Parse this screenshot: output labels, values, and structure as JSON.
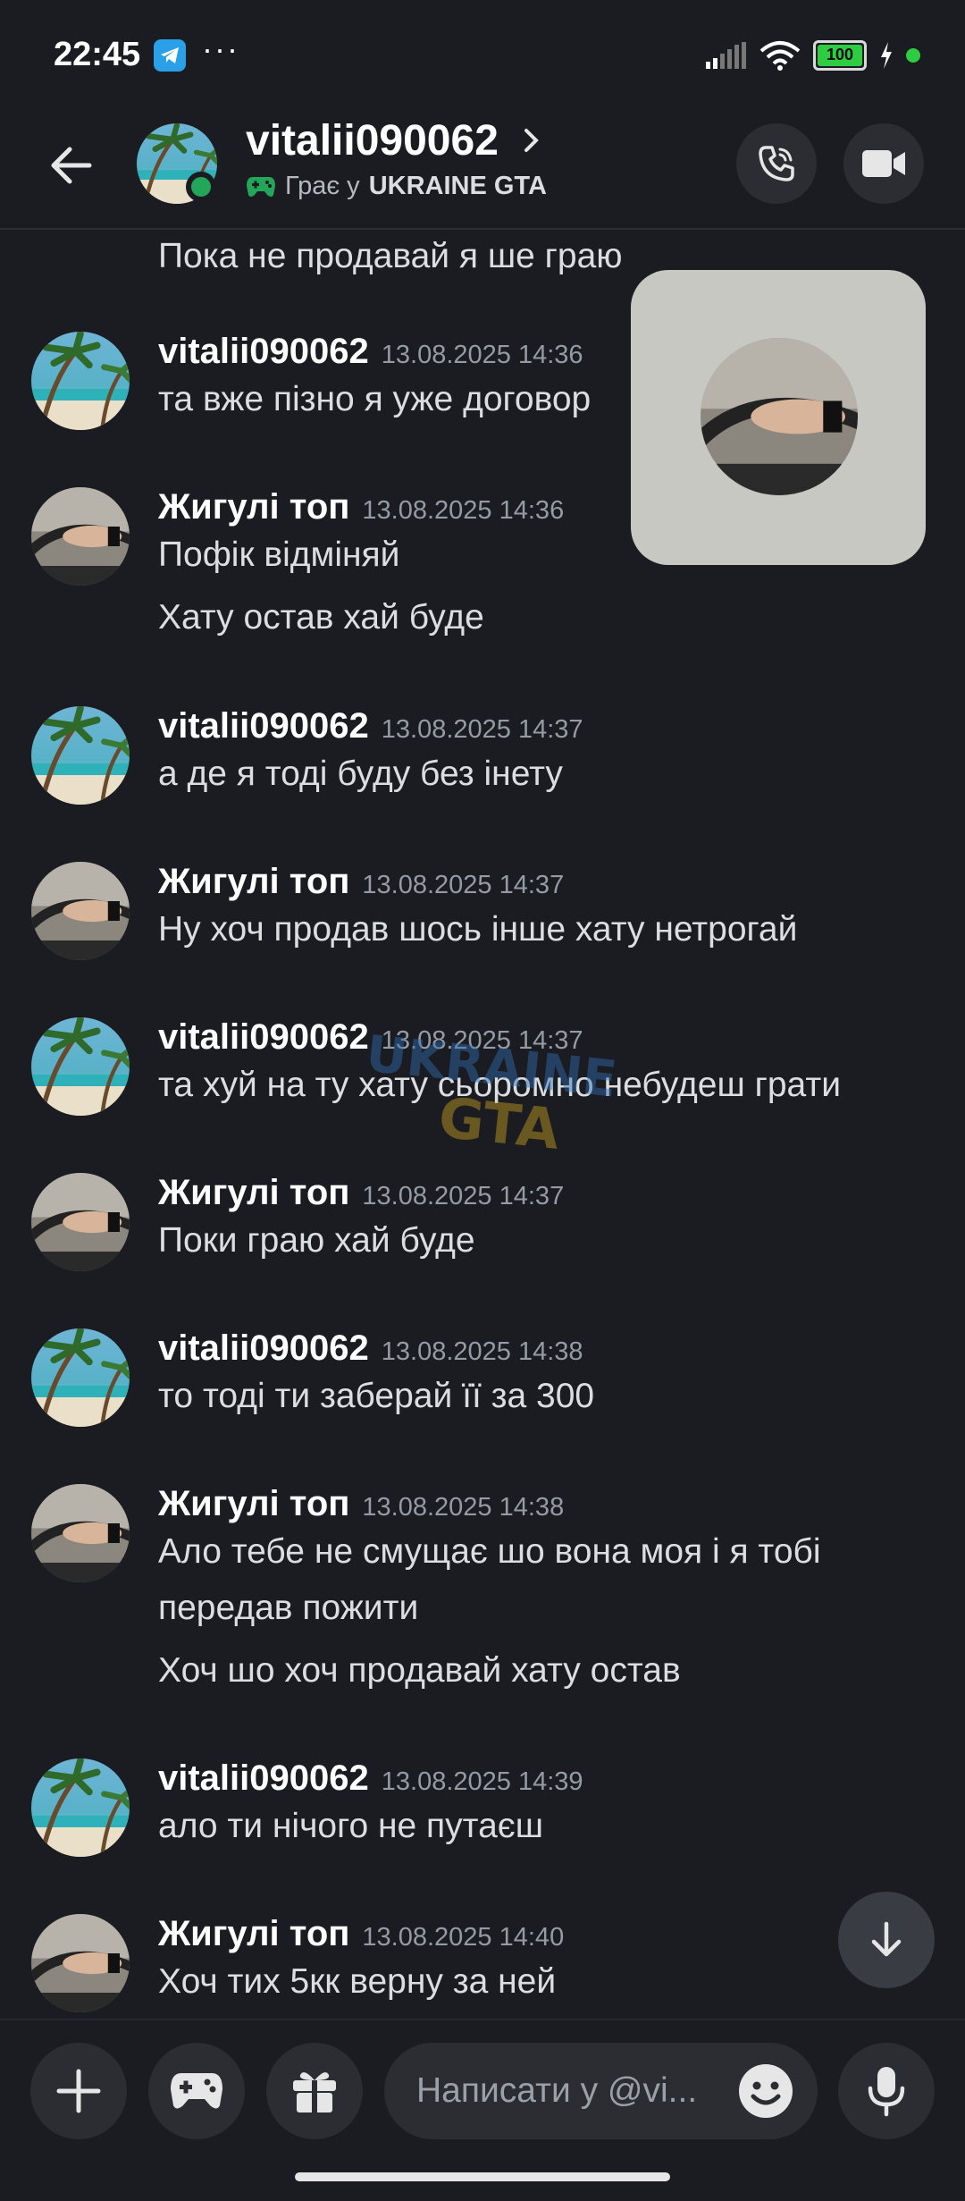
{
  "status_bar": {
    "time": "22:45",
    "more": "···",
    "battery": "100"
  },
  "header": {
    "username": "vitalii090062",
    "activity_prefix": "Грає у",
    "activity_game": "UKRAINE GTA"
  },
  "messages": [
    {
      "lines": [
        "Пока не продавай я ше граю"
      ]
    },
    {
      "author": "vitalii090062",
      "time": "13.08.2025 14:36",
      "lines": [
        "та вже пізно я уже договор"
      ]
    },
    {
      "author": "Жигулі топ",
      "time": "13.08.2025 14:36",
      "lines": [
        "Пофік відміняй",
        "Хату остав хай буде"
      ]
    },
    {
      "author": "vitalii090062",
      "time": "13.08.2025 14:37",
      "lines": [
        "а де я тоді буду без інету"
      ]
    },
    {
      "author": "Жигулі топ",
      "time": "13.08.2025 14:37",
      "lines": [
        "Ну хоч продав шось інше хату нетрогай"
      ]
    },
    {
      "author": "vitalii090062",
      "time": "13.08.2025 14:37",
      "lines": [
        "та хуй на ту хату сьоромно небудеш грати"
      ]
    },
    {
      "author": "Жигулі топ",
      "time": "13.08.2025 14:37",
      "lines": [
        "Поки граю хай буде"
      ]
    },
    {
      "author": "vitalii090062",
      "time": "13.08.2025 14:38",
      "lines": [
        "то тоді ти заберай її за 300"
      ]
    },
    {
      "author": "Жигулі топ",
      "time": "13.08.2025 14:38",
      "lines": [
        "Ало тебе не смущає шо вона моя і я тобі",
        "передав пожити",
        "Хоч шо хоч продавай хату остав"
      ]
    },
    {
      "author": "vitalii090062",
      "time": "13.08.2025 14:39",
      "lines": [
        "ало ти нічого не путаєш"
      ]
    },
    {
      "author": "Жигулі топ",
      "time": "13.08.2025 14:40",
      "lines": [
        "Хоч тих 5кк верну за ней"
      ]
    }
  ],
  "composer": {
    "placeholder": "Написати у @vi..."
  },
  "icons": {
    "back": "arrow-left-icon",
    "call": "phone-icon",
    "video": "video-camera-icon",
    "add": "plus-icon",
    "games": "gamepad-icon",
    "gift": "gift-icon",
    "emoji": "smile-icon",
    "mic": "microphone-icon",
    "scroll": "arrow-down-icon"
  },
  "colors": {
    "background": "#1b1c21",
    "online": "#23a55a",
    "activity_icon": "#23a55a",
    "timestamp": "#949ba4"
  }
}
